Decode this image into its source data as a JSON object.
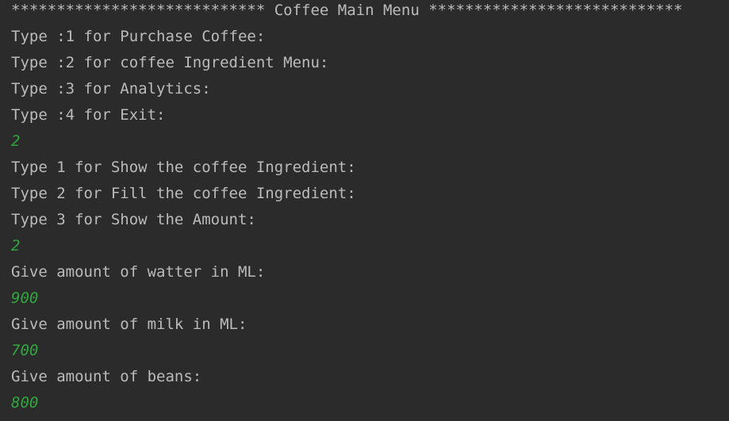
{
  "console": {
    "lines": [
      {
        "type": "output",
        "text": "**************************** Coffee Main Menu ****************************"
      },
      {
        "type": "output",
        "text": "Type :1 for Purchase Coffee:"
      },
      {
        "type": "output",
        "text": "Type :2 for coffee Ingredient Menu:"
      },
      {
        "type": "output",
        "text": "Type :3 for Analytics:"
      },
      {
        "type": "output",
        "text": "Type :4 for Exit:"
      },
      {
        "type": "input",
        "text": "2"
      },
      {
        "type": "output",
        "text": "Type 1 for Show the coffee Ingredient:"
      },
      {
        "type": "output",
        "text": "Type 2 for Fill the coffee Ingredient:"
      },
      {
        "type": "output",
        "text": "Type 3 for Show the Amount:"
      },
      {
        "type": "input",
        "text": "2"
      },
      {
        "type": "output",
        "text": "Give amount of watter in ML:"
      },
      {
        "type": "input",
        "text": "900"
      },
      {
        "type": "output",
        "text": "Give amount of milk in ML:"
      },
      {
        "type": "input",
        "text": "700"
      },
      {
        "type": "output",
        "text": "Give amount of beans:"
      },
      {
        "type": "input",
        "text": "800"
      }
    ]
  }
}
